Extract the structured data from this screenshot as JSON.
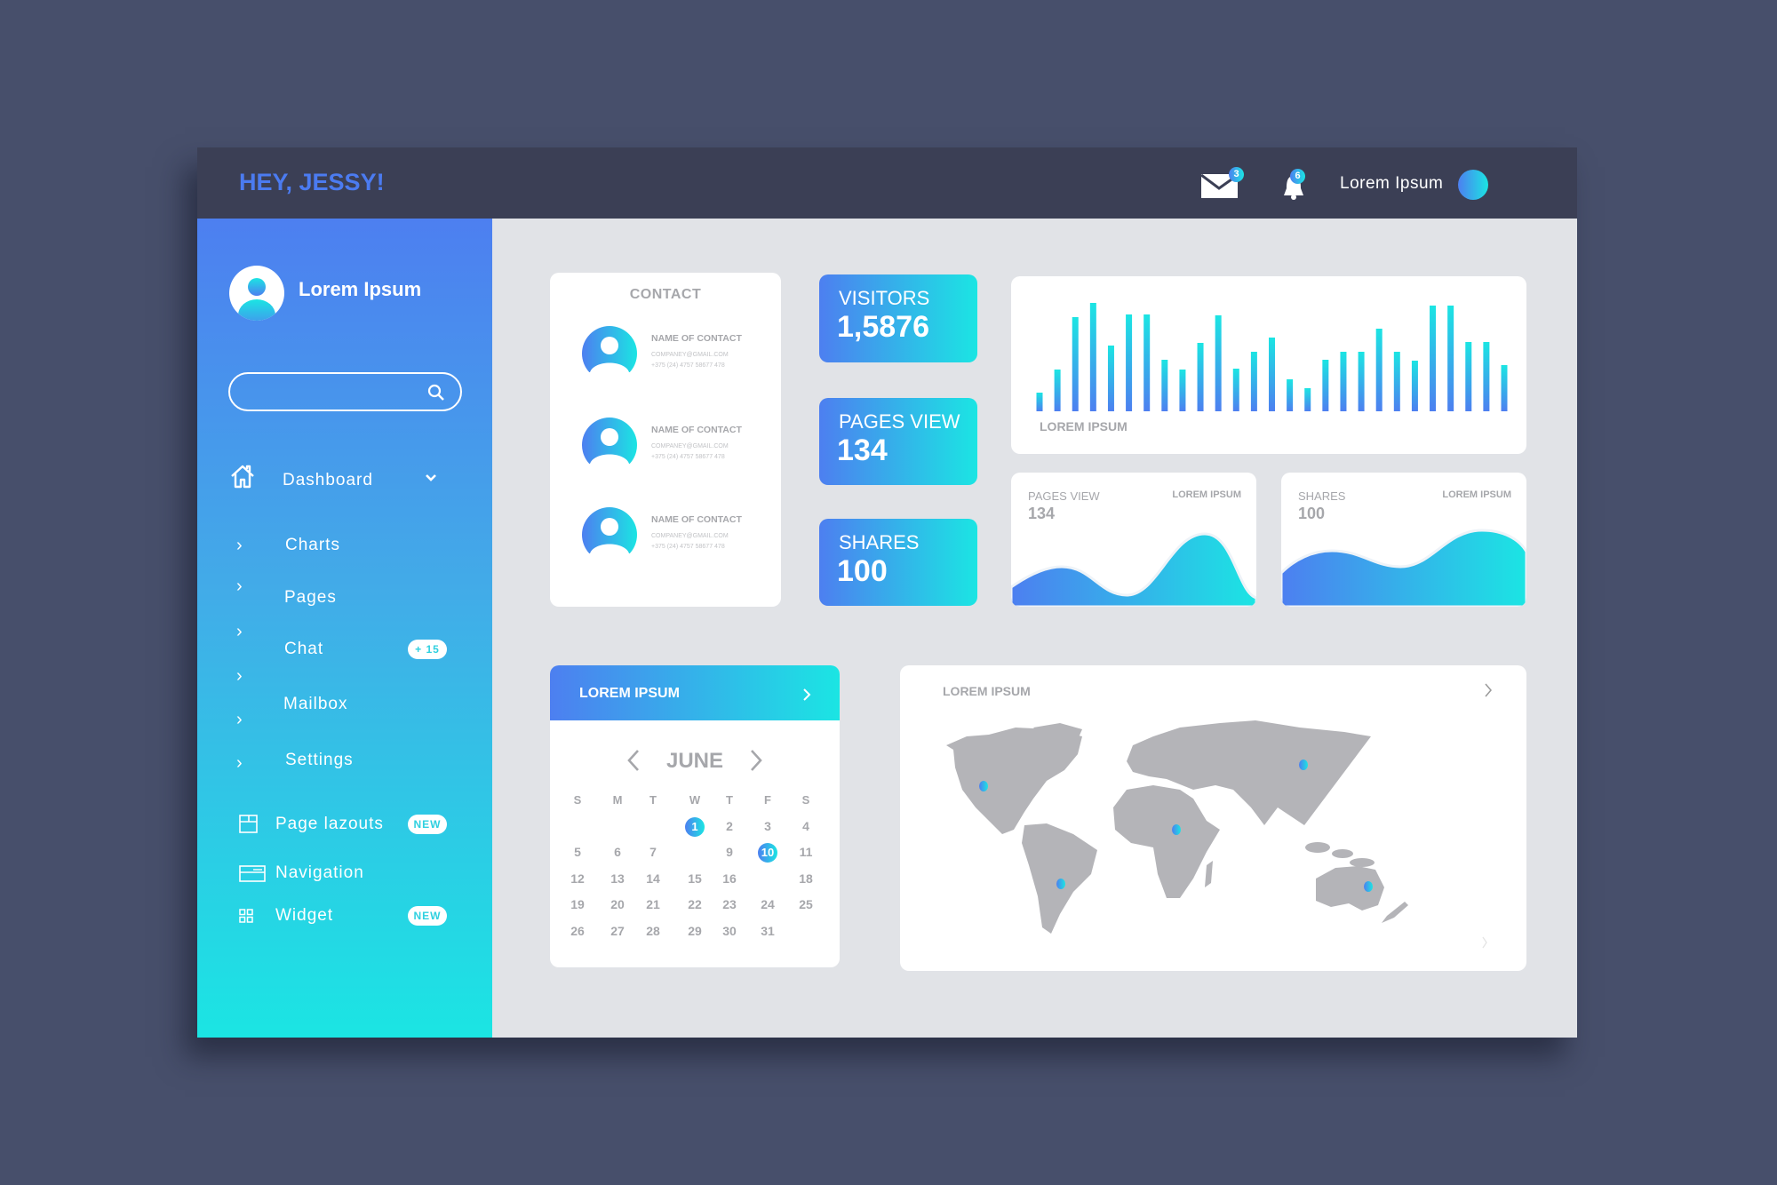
{
  "header": {
    "greeting": "HEY, JESSY!",
    "mail_count": "3",
    "notification_count": "6",
    "user_name": "Lorem Ipsum"
  },
  "sidebar": {
    "profile_name": "Lorem Ipsum",
    "search": {
      "value": "",
      "placeholder": ""
    },
    "dashboard_label": "Dashboard",
    "submenu": [
      {
        "label": "Charts"
      },
      {
        "label": "Pages"
      },
      {
        "label": "Chat",
        "badge": "+ 15"
      },
      {
        "label": "Mailbox"
      },
      {
        "label": "Settings"
      }
    ],
    "extra": [
      {
        "label": "Page lazouts",
        "badge": "NEW",
        "icon": "layout-icon"
      },
      {
        "label": "Navigation",
        "icon": "navigation-icon"
      },
      {
        "label": "Widget",
        "badge": "NEW",
        "icon": "widget-icon"
      }
    ]
  },
  "contact": {
    "title": "CONTACT",
    "items": [
      {
        "name": "NAME OF CONTACT",
        "email": "COMPANEY@GMAIL.COM",
        "phone": "+375 (24) 4757 58677 478"
      },
      {
        "name": "NAME OF CONTACT",
        "email": "COMPANEY@GMAIL.COM",
        "phone": "+375 (24) 4757 58677 478"
      },
      {
        "name": "NAME OF CONTACT",
        "email": "COMPANEY@GMAIL.COM",
        "phone": "+375 (24) 4757 58677 478"
      }
    ]
  },
  "stats": [
    {
      "label": "VISITORS",
      "value": "1,5876"
    },
    {
      "label": "PAGES VIEW",
      "value": "134"
    },
    {
      "label": "SHARES",
      "value": "100"
    }
  ],
  "bar_card": {
    "label": "LOREM IPSUM"
  },
  "area_cards": [
    {
      "label": "PAGES VIEW",
      "value": "134",
      "caption": "LOREM IPSUM"
    },
    {
      "label": "SHARES",
      "value": "100",
      "caption": "LOREM IPSUM"
    }
  ],
  "calendar": {
    "header": "LOREM IPSUM",
    "month": "JUNE",
    "weekdays": [
      "S",
      "M",
      "T",
      "W",
      "T",
      "F",
      "S"
    ],
    "rows": [
      [
        "",
        "",
        "",
        "1",
        "2",
        "3",
        "4"
      ],
      [
        "5",
        "6",
        "7",
        "",
        "9",
        "10",
        "11"
      ],
      [
        "12",
        "13",
        "14",
        "15",
        "16",
        "",
        "18"
      ],
      [
        "19",
        "20",
        "21",
        "22",
        "23",
        "24",
        "25"
      ],
      [
        "26",
        "27",
        "28",
        "29",
        "30",
        "31",
        ""
      ]
    ],
    "highlighted": [
      "1",
      "10"
    ]
  },
  "map_card": {
    "title": "LOREM IPSUM"
  },
  "colors": {
    "accent_start": "#4d7ff0",
    "accent_end": "#1be5e3",
    "header_bg": "#3b3f55",
    "page_bg": "#474f6b"
  },
  "chart_data": {
    "type": "bar",
    "title": "",
    "xlabel": "LOREM IPSUM",
    "values": [
      21,
      47,
      106,
      122,
      74,
      109,
      109,
      58,
      47,
      77,
      108,
      48,
      67,
      83,
      36,
      26,
      58,
      67,
      67,
      93,
      67,
      57,
      119,
      119,
      78,
      78,
      52
    ],
    "grid": false
  }
}
